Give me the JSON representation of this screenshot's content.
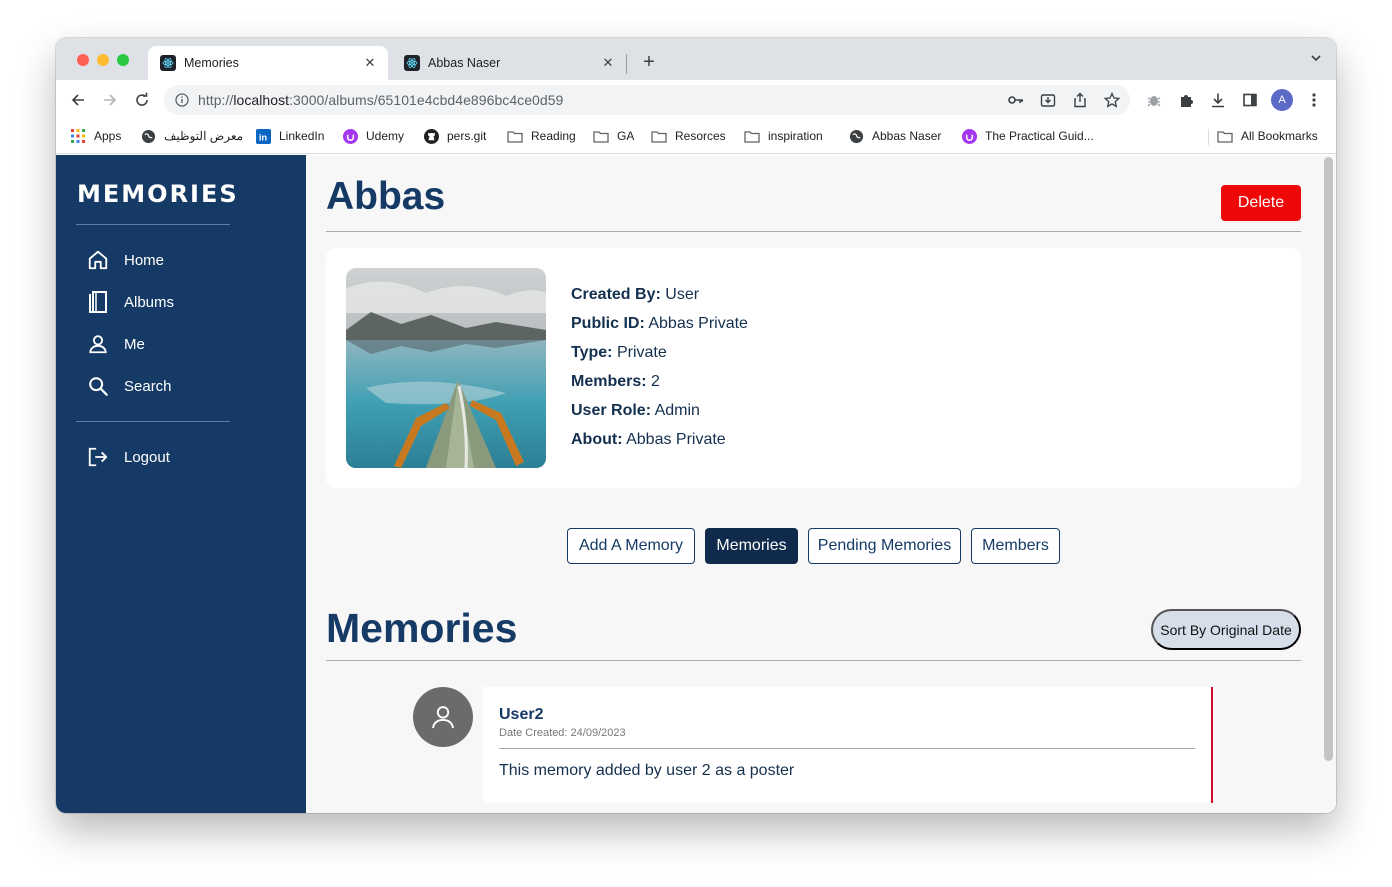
{
  "browser": {
    "tabs": [
      {
        "title": "Memories",
        "active": true
      },
      {
        "title": "Abbas Naser",
        "active": false
      }
    ],
    "url_prefix": "http://",
    "url_host": "localhost",
    "url_path": ":3000/albums/65101e4cbd4e896bc4ce0d59",
    "profile_initial": "A",
    "bookmarks": [
      "Apps",
      "معرض التوظيف",
      "LinkedIn",
      "Udemy",
      "pers.git",
      "Reading",
      "GA",
      "Resorces",
      "inspiration",
      "Abbas Naser",
      "The Practical Guid...",
      "All Bookmarks"
    ]
  },
  "sidebar": {
    "logo": "MEMORIES",
    "items": [
      {
        "label": "Home",
        "icon": "home-icon"
      },
      {
        "label": "Albums",
        "icon": "book-icon"
      },
      {
        "label": "Me",
        "icon": "user-icon"
      },
      {
        "label": "Search",
        "icon": "search-icon"
      }
    ],
    "logout_label": "Logout"
  },
  "album": {
    "title": "Abbas",
    "delete_label": "Delete",
    "details": [
      {
        "key": "Created By:",
        "value": "User"
      },
      {
        "key": "Public ID:",
        "value": "Abbas Private"
      },
      {
        "key": "Type:",
        "value": "Private"
      },
      {
        "key": "Members:",
        "value": "2"
      },
      {
        "key": "User Role:",
        "value": "Admin"
      },
      {
        "key": "About:",
        "value": "Abbas Private"
      }
    ]
  },
  "section_tabs": [
    {
      "label": "Add A Memory",
      "active": false
    },
    {
      "label": "Memories",
      "active": true
    },
    {
      "label": "Pending Memories",
      "active": false
    },
    {
      "label": "Members",
      "active": false
    }
  ],
  "memories_section": {
    "title": "Memories",
    "sort_label": "Sort By Original Date",
    "items": [
      {
        "user": "User2",
        "date": "Date Created: 24/09/2023",
        "text": "This memory added by user 2 as a poster"
      }
    ]
  },
  "colors": {
    "sidebar": "#163a66",
    "delete": "#ee0808",
    "active_tab": "#0f2a4a",
    "memory_border": "#d0102b"
  }
}
